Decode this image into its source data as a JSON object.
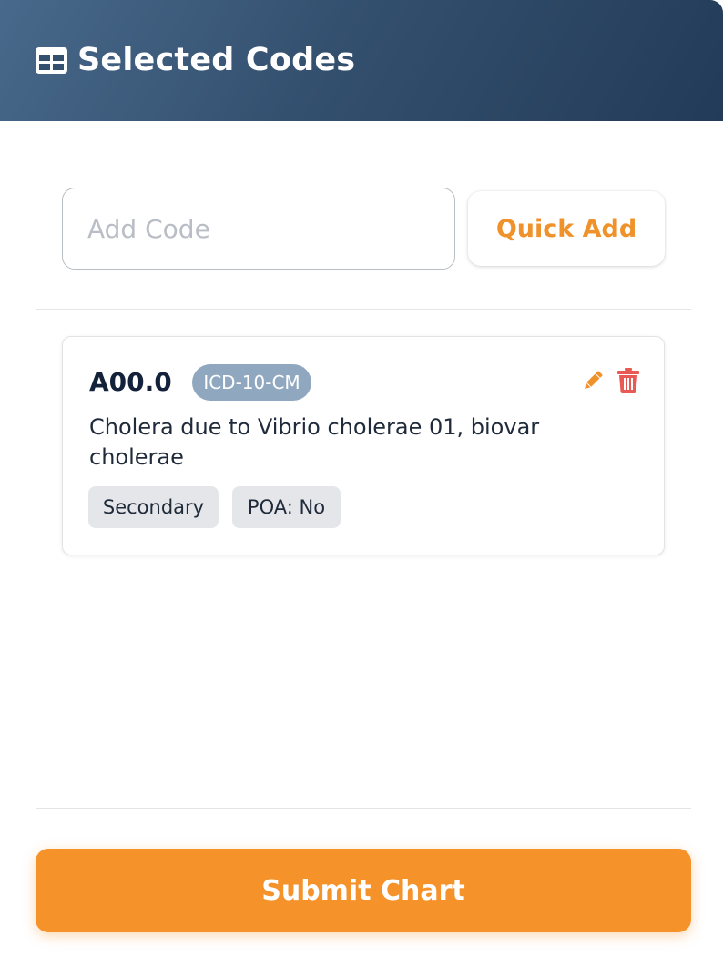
{
  "header": {
    "icon": "table-icon",
    "title": "Selected Codes"
  },
  "add_code": {
    "placeholder": "Add Code",
    "value": "",
    "quick_add_label": "Quick Add"
  },
  "codes": [
    {
      "code": "A00.0",
      "system": "ICD-10-CM",
      "description": "Cholera due to Vibrio cholerae 01, biovar cholerae",
      "sequence": "Secondary",
      "poa": "POA: No",
      "actions": {
        "edit_icon": "pencil-icon",
        "delete_icon": "trash-icon"
      }
    }
  ],
  "footer": {
    "submit_label": "Submit Chart"
  },
  "colors": {
    "accent": "#f6922a",
    "header_start": "#48698b",
    "header_end": "#223b58",
    "system_badge": "#8fa8c0",
    "delete": "#ea5a55",
    "tag_bg": "#e4e6e9"
  }
}
